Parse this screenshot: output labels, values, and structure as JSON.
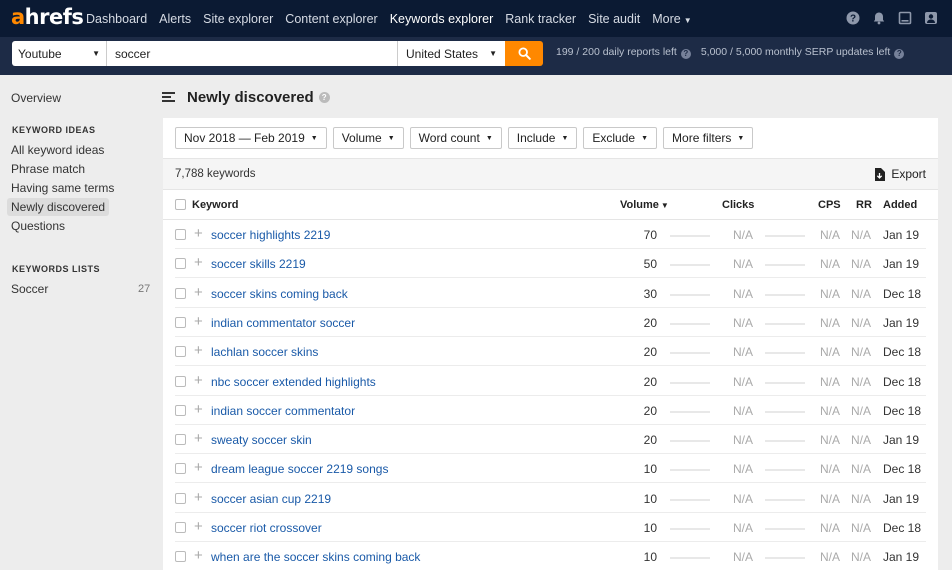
{
  "app": {
    "logo_a": "a",
    "logo_rest": "hrefs"
  },
  "nav": [
    {
      "label": "Dashboard",
      "active": false
    },
    {
      "label": "Alerts",
      "active": false
    },
    {
      "label": "Site explorer",
      "active": false
    },
    {
      "label": "Content explorer",
      "active": false
    },
    {
      "label": "Keywords explorer",
      "active": true
    },
    {
      "label": "Rank tracker",
      "active": false
    },
    {
      "label": "Site audit",
      "active": false
    },
    {
      "label": "More",
      "active": false,
      "dropdown": true
    }
  ],
  "nav_icons": [
    "help-icon",
    "bell-icon",
    "monitor-icon",
    "account-icon"
  ],
  "search": {
    "mode": "Youtube",
    "query": "soccer",
    "country": "United States",
    "button_icon": "search-icon",
    "limits": [
      "199 / 200 daily reports left",
      "5,000 / 5,000 monthly SERP updates left"
    ]
  },
  "sidebar": {
    "overview": "Overview",
    "ideas_heading": "KEYWORD IDEAS",
    "ideas": [
      {
        "label": "All keyword ideas",
        "active": false
      },
      {
        "label": "Phrase match",
        "active": false
      },
      {
        "label": "Having same terms",
        "active": false
      },
      {
        "label": "Newly discovered",
        "active": true
      },
      {
        "label": "Questions",
        "active": false
      }
    ],
    "lists_heading": "KEYWORDS LISTS",
    "lists": [
      {
        "label": "Soccer",
        "count": "27"
      }
    ]
  },
  "main": {
    "title": "Newly discovered",
    "filters": [
      "Nov 2018 — Feb 2019",
      "Volume",
      "Word count",
      "Include",
      "Exclude",
      "More filters"
    ],
    "keyword_count": "7,788 keywords",
    "export_label": "Export",
    "columns": {
      "keyword": "Keyword",
      "volume": "Volume",
      "clicks": "Clicks",
      "cps": "CPS",
      "rr": "RR",
      "added": "Added"
    },
    "rows": [
      {
        "keyword": "soccer highlights 2219",
        "volume": "70",
        "clicks": "N/A",
        "cps": "N/A",
        "rr": "N/A",
        "added": "Jan 19"
      },
      {
        "keyword": "soccer skills 2219",
        "volume": "50",
        "clicks": "N/A",
        "cps": "N/A",
        "rr": "N/A",
        "added": "Jan 19"
      },
      {
        "keyword": "soccer skins coming back",
        "volume": "30",
        "clicks": "N/A",
        "cps": "N/A",
        "rr": "N/A",
        "added": "Dec 18"
      },
      {
        "keyword": "indian commentator soccer",
        "volume": "20",
        "clicks": "N/A",
        "cps": "N/A",
        "rr": "N/A",
        "added": "Jan 19"
      },
      {
        "keyword": "lachlan soccer skins",
        "volume": "20",
        "clicks": "N/A",
        "cps": "N/A",
        "rr": "N/A",
        "added": "Dec 18"
      },
      {
        "keyword": "nbc soccer extended highlights",
        "volume": "20",
        "clicks": "N/A",
        "cps": "N/A",
        "rr": "N/A",
        "added": "Dec 18"
      },
      {
        "keyword": "indian soccer commentator",
        "volume": "20",
        "clicks": "N/A",
        "cps": "N/A",
        "rr": "N/A",
        "added": "Dec 18"
      },
      {
        "keyword": "sweaty soccer skin",
        "volume": "20",
        "clicks": "N/A",
        "cps": "N/A",
        "rr": "N/A",
        "added": "Jan 19"
      },
      {
        "keyword": "dream league soccer 2219 songs",
        "volume": "10",
        "clicks": "N/A",
        "cps": "N/A",
        "rr": "N/A",
        "added": "Dec 18"
      },
      {
        "keyword": "soccer asian cup 2219",
        "volume": "10",
        "clicks": "N/A",
        "cps": "N/A",
        "rr": "N/A",
        "added": "Jan 19"
      },
      {
        "keyword": "soccer riot crossover",
        "volume": "10",
        "clicks": "N/A",
        "cps": "N/A",
        "rr": "N/A",
        "added": "Dec 18"
      },
      {
        "keyword": "when are the soccer skins coming back",
        "volume": "10",
        "clicks": "N/A",
        "cps": "N/A",
        "rr": "N/A",
        "added": "Jan 19"
      }
    ]
  },
  "colors": {
    "nav_bg": "#0b1a33",
    "search_bg": "#1d2b46",
    "accent": "#ff8800",
    "link": "#1a5aa8"
  }
}
